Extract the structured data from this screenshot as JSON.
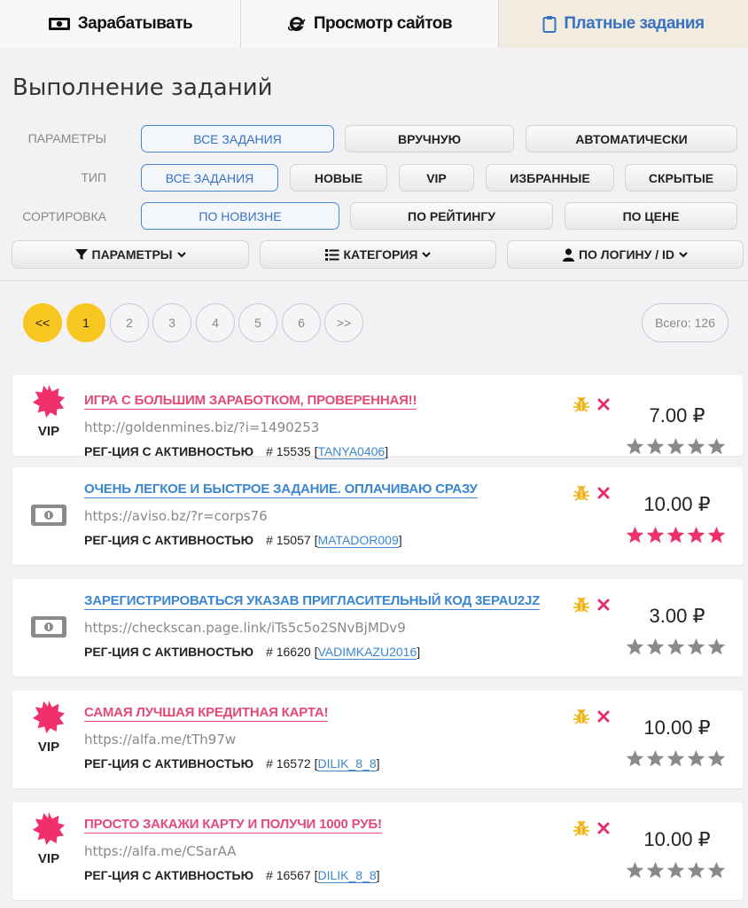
{
  "tabs": [
    {
      "label": "Зарабатывать",
      "icon": "money-icon"
    },
    {
      "label": "Просмотр сайтов",
      "icon": "browser-icon"
    },
    {
      "label": "Платные задания",
      "icon": "clipboard-icon"
    }
  ],
  "page_title": "Выполнение заданий",
  "filters": {
    "params": {
      "label": "ПАРАМЕТРЫ",
      "options": [
        "ВСЕ ЗАДАНИЯ",
        "ВРУЧНУЮ",
        "АВТОМАТИЧЕСКИ"
      ],
      "selected": "ВСЕ ЗАДАНИЯ"
    },
    "type": {
      "label": "ТИП",
      "options": [
        "ВСЕ ЗАДАНИЯ",
        "НОВЫЕ",
        "VIP",
        "ИЗБРАННЫЕ",
        "СКРЫТЫЕ"
      ],
      "selected": "ВСЕ ЗАДАНИЯ"
    },
    "sort": {
      "label": "СОРТИРОВКА",
      "options": [
        "ПО НОВИЗНЕ",
        "ПО РЕЙТИНГУ",
        "ПО ЦЕНЕ"
      ],
      "selected": "ПО НОВИЗНЕ"
    }
  },
  "dropdowns": [
    "ПАРАМЕТРЫ",
    "КАТЕГОРИЯ",
    "ПО ЛОГИНУ / ID"
  ],
  "pagination": {
    "first": "<<",
    "pages": [
      "1",
      "2",
      "3",
      "4",
      "5",
      "6"
    ],
    "next": ">>",
    "current": "1",
    "total": "Всего: 126"
  },
  "colors": {
    "accent_blue": "#3a86d0",
    "vip_pink": "#e44a78",
    "yellow": "#f7c620",
    "star_grey": "#8a8a8a"
  },
  "tasks": [
    {
      "vip": true,
      "vip_label": "VIP",
      "title": "ИГРА С БОЛЬШИМ ЗАРАБОТКОМ, ПРОВЕРЕННАЯ!!",
      "url": "http://goldenmines.biz/?i=1490253",
      "kind": "РЕГ-ЦИЯ С АКТИВНОСТЬЮ",
      "id": "# 15535",
      "user": "TANYA0406",
      "price": "7.00 ₽",
      "rating": 0
    },
    {
      "vip": false,
      "title": "ОЧЕНЬ ЛЕГКОЕ И БЫСТРОЕ ЗАДАНИЕ. ОПЛАЧИВАЮ СРАЗУ",
      "url": "https://aviso.bz/?r=corps76",
      "kind": "РЕГ-ЦИЯ С АКТИВНОСТЬЮ",
      "id": "# 15057",
      "user": "MATADOR009",
      "price": "10.00 ₽",
      "rating": 5
    },
    {
      "vip": false,
      "title": "ЗАРЕГИСТРИРОВАТЬСЯ УКАЗАВ ПРИГЛАСИТЕЛЬНЫЙ КОД 3EPAU2JZ",
      "url": "https://checkscan.page.link/iTs5c5o2SNvBjMDv9",
      "kind": "РЕГ-ЦИЯ С АКТИВНОСТЬЮ",
      "id": "# 16620",
      "user": "VADIMKAZU2016",
      "price": "3.00 ₽",
      "rating": 0
    },
    {
      "vip": true,
      "vip_label": "VIP",
      "title": "САМАЯ ЛУЧШАЯ КРЕДИТНАЯ КАРТА!",
      "url": "https://alfa.me/tTh97w",
      "kind": "РЕГ-ЦИЯ С АКТИВНОСТЬЮ",
      "id": "# 16572",
      "user": "DILIK_8_8",
      "price": "10.00 ₽",
      "rating": 0
    },
    {
      "vip": true,
      "vip_label": "VIP",
      "title": "ПРОСТО ЗАКАЖИ КАРТУ И ПОЛУЧИ 1000 РУБ!",
      "url": "https://alfa.me/CSarAA",
      "kind": "РЕГ-ЦИЯ С АКТИВНОСТЬЮ",
      "id": "# 16567",
      "user": "DILIK_8_8",
      "price": "10.00 ₽",
      "rating": 0
    }
  ]
}
